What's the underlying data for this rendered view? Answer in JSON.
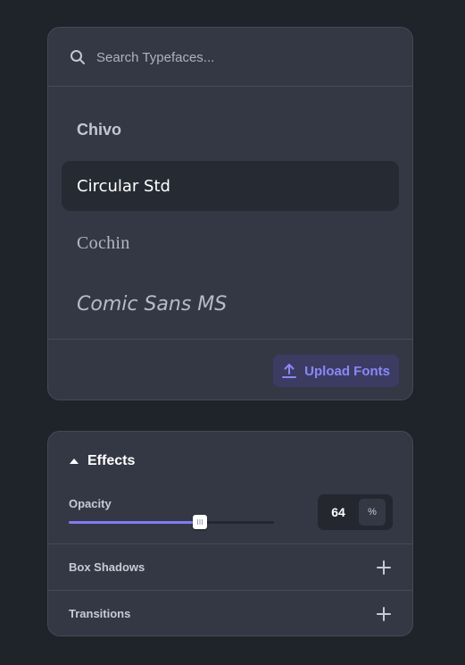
{
  "typeface_picker": {
    "search": {
      "placeholder": "Search Typefaces...",
      "value": ""
    },
    "fonts": [
      {
        "name": "Chivo",
        "selected": false
      },
      {
        "name": "Circular Std",
        "selected": true
      },
      {
        "name": "Cochin",
        "selected": false
      },
      {
        "name": "Comic Sans MS",
        "selected": false
      }
    ],
    "upload_label": "Upload Fonts"
  },
  "effects": {
    "title": "Effects",
    "expanded": true,
    "opacity": {
      "label": "Opacity",
      "value": "64",
      "unit": "%",
      "fraction": 0.64
    },
    "rows": [
      {
        "label": "Box Shadows"
      },
      {
        "label": "Transitions"
      }
    ]
  },
  "colors": {
    "accent": "#7f7cf0",
    "background": "#1f232a",
    "panel": "#343844",
    "selected_item": "#262a33"
  },
  "icons": [
    "search-icon",
    "upload-icon",
    "caret-up-icon",
    "grip-icon",
    "plus-icon"
  ]
}
